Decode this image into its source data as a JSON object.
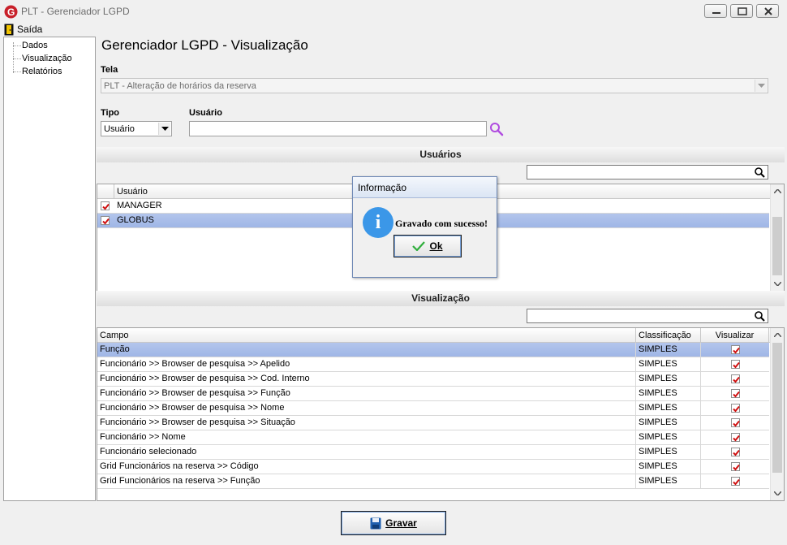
{
  "window": {
    "title": "PLT - Gerenciador LGPD"
  },
  "menu": {
    "exit_label": "Saída"
  },
  "tree": {
    "items": [
      "Dados",
      "Visualização",
      "Relatórios"
    ]
  },
  "page": {
    "title": "Gerenciador LGPD - Visualização"
  },
  "tela": {
    "label": "Tela",
    "value": "PLT - Alteração de horários da reserva"
  },
  "tipo": {
    "label": "Tipo",
    "value": "Usuário"
  },
  "usuario": {
    "label": "Usuário",
    "value": ""
  },
  "users_section": {
    "header": "Usuários",
    "column": "Usuário",
    "rows": [
      {
        "name": "MANAGER",
        "checked": true
      },
      {
        "name": "GLOBUS",
        "checked": true,
        "selected": true
      }
    ]
  },
  "view_section": {
    "header": "Visualização",
    "columns": {
      "field": "Campo",
      "class": "Classificação",
      "view": "Visualizar"
    },
    "rows": [
      {
        "field": "Função",
        "class": "SIMPLES",
        "view": true
      },
      {
        "field": "Funcionário >> Browser de pesquisa >> Apelido",
        "class": "SIMPLES",
        "view": true
      },
      {
        "field": "Funcionário >> Browser de pesquisa >> Cod. Interno",
        "class": "SIMPLES",
        "view": true
      },
      {
        "field": "Funcionário >> Browser de pesquisa >> Função",
        "class": "SIMPLES",
        "view": true
      },
      {
        "field": "Funcionário >> Browser de pesquisa >> Nome",
        "class": "SIMPLES",
        "view": true
      },
      {
        "field": "Funcionário >> Browser de pesquisa >> Situação",
        "class": "SIMPLES",
        "view": true
      },
      {
        "field": "Funcionário >> Nome",
        "class": "SIMPLES",
        "view": true
      },
      {
        "field": "Funcionário selecionado",
        "class": "SIMPLES",
        "view": true
      },
      {
        "field": "Grid Funcionários na reserva >> Código",
        "class": "SIMPLES",
        "view": true
      },
      {
        "field": "Grid Funcionários na reserva >> Função",
        "class": "SIMPLES",
        "view": true
      }
    ]
  },
  "save_button": {
    "label": "Gravar"
  },
  "dialog": {
    "title": "Informação",
    "message": "Gravado com sucesso!",
    "ok_label": "Ok"
  },
  "colors": {
    "selection": "#9fb6e6",
    "check": "#d01010",
    "info": "#3b97e8",
    "search": "#b04ce0"
  }
}
